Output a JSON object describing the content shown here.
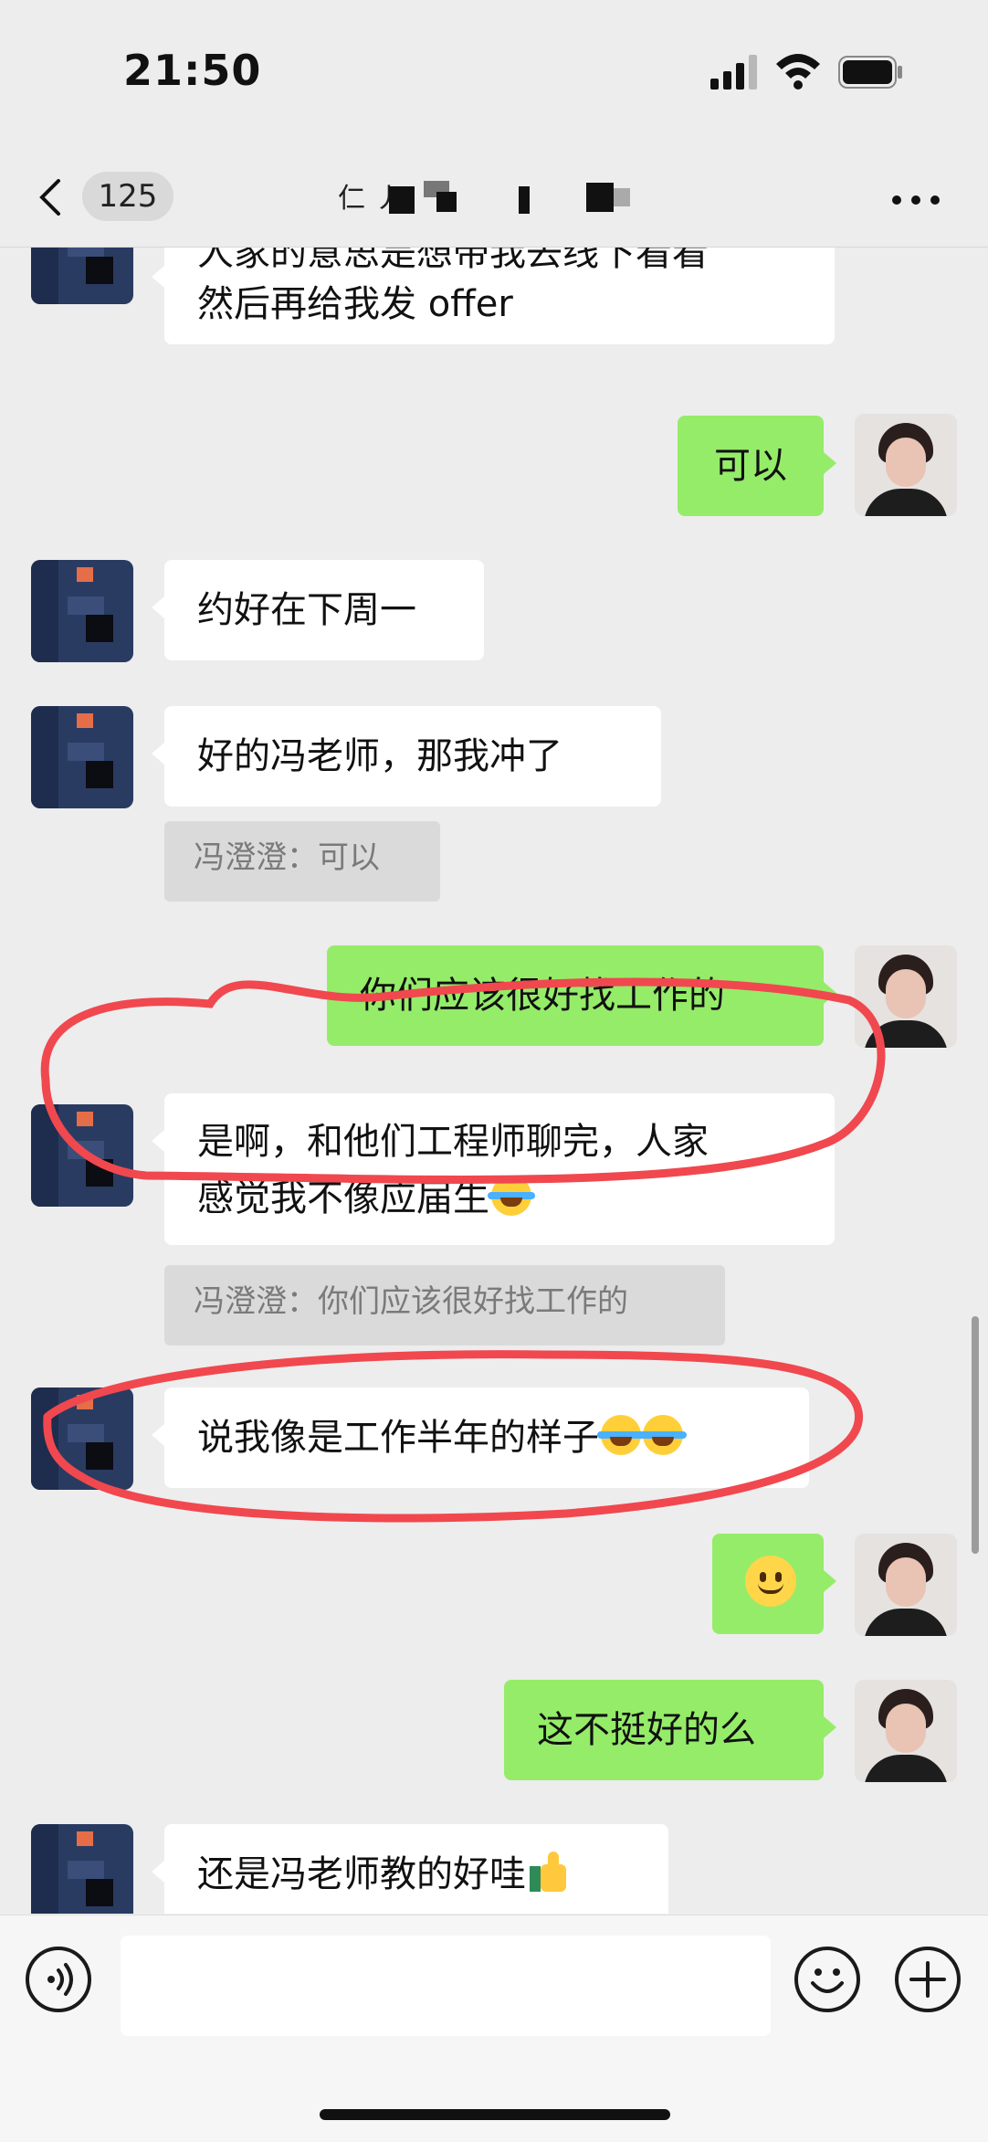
{
  "status_bar": {
    "time": "21:50"
  },
  "header": {
    "unread_count": "125",
    "title_fragment": "仁 丿"
  },
  "messages": [
    {
      "side": "left",
      "lines": [
        "人家的意思是想带我去线下看看",
        "然后再给我发 offer"
      ]
    },
    {
      "side": "right",
      "text": "可以"
    },
    {
      "side": "left",
      "text": "约好在下周一"
    },
    {
      "side": "left",
      "text": "好的冯老师，那我冲了"
    },
    {
      "quote": "冯澄澄：可以"
    },
    {
      "side": "right",
      "text": "你们应该很好找工作的"
    },
    {
      "side": "left",
      "lines": [
        "是啊，和他们工程师聊完，人家",
        "感觉我不像应届生"
      ],
      "emoji_after": "grinning-squinting-face"
    },
    {
      "quote": "冯澄澄：你们应该很好找工作的"
    },
    {
      "side": "left",
      "text": "说我像是工作半年的样子",
      "emoji_after": "grinning-squinting-face x2"
    },
    {
      "side": "right",
      "emoji": "smiling-face"
    },
    {
      "side": "right",
      "text": "这不挺好的么"
    },
    {
      "side": "left",
      "text": "还是冯老师教的好哇",
      "emoji_after": "thumbs-up"
    }
  ],
  "icons": {
    "back": "chevron-left-icon",
    "more": "more-dots-icon",
    "voice": "voice-icon",
    "emoji": "emoji-icon",
    "plus": "plus-icon"
  },
  "colors": {
    "background": "#ededed",
    "bubble_self": "#95ec69",
    "bubble_other": "#ffffff",
    "annotation": "#f0484e"
  }
}
